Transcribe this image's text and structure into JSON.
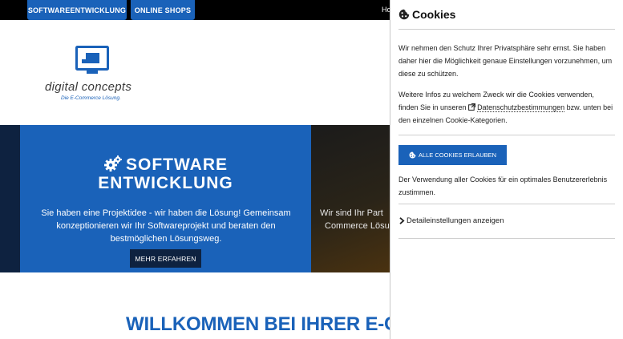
{
  "nav": {
    "tabs": [
      "SOFTWAREENTWICKLUNG",
      "ONLINE SHOPS"
    ],
    "home_partial": "Ho"
  },
  "logo": {
    "name": "digital concepts",
    "tagline": "Die E-Commerce Lösung."
  },
  "hero": {
    "title_line1": "SOFTWARE",
    "title_line2": "ENTWICKLUNG",
    "text": "Sie haben eine Projektidee - wir haben die Lösung! Gemeinsam konzeptionieren wir Ihr Softwareprojekt und beraten den bestmöglichen Lösungsweg.",
    "button": "MEHR ERFAHREN",
    "side_text_line1": "Wir sind Ihr Part",
    "side_text_line2": "Commerce Lösu"
  },
  "welcome": "WILLKOMMEN BEI IHRER E-C",
  "cookie": {
    "title": "Cookies",
    "intro": "Wir nehmen den Schutz Ihrer Privatsphäre sehr ernst. Sie haben daher hier die Möglichkeit genaue Einstellungen vorzunehmen, um diese zu schützen.",
    "info_before": "Weitere Infos zu welchem Zweck wir die Cookies verwenden, finden Sie in unseren ",
    "info_link": "Datenschutzbestimmungen",
    "info_after": " bzw. unten bei den einzelnen Cookie-Kategorien.",
    "accept_button": "ALLE COOKIES ERLAUBEN",
    "accept_note": "Der Verwendung aller Cookies für ein optimales Benutzererlebnis zustimmen.",
    "details_label": "Detaileinstellungen anzeigen"
  },
  "colors": {
    "brand_blue": "#1a62b9",
    "navy": "#0e2240"
  },
  "icons": [
    "gear-icon",
    "cookie-icon",
    "external-link-icon",
    "chevron-right-icon",
    "logo-monitor-icon"
  ]
}
